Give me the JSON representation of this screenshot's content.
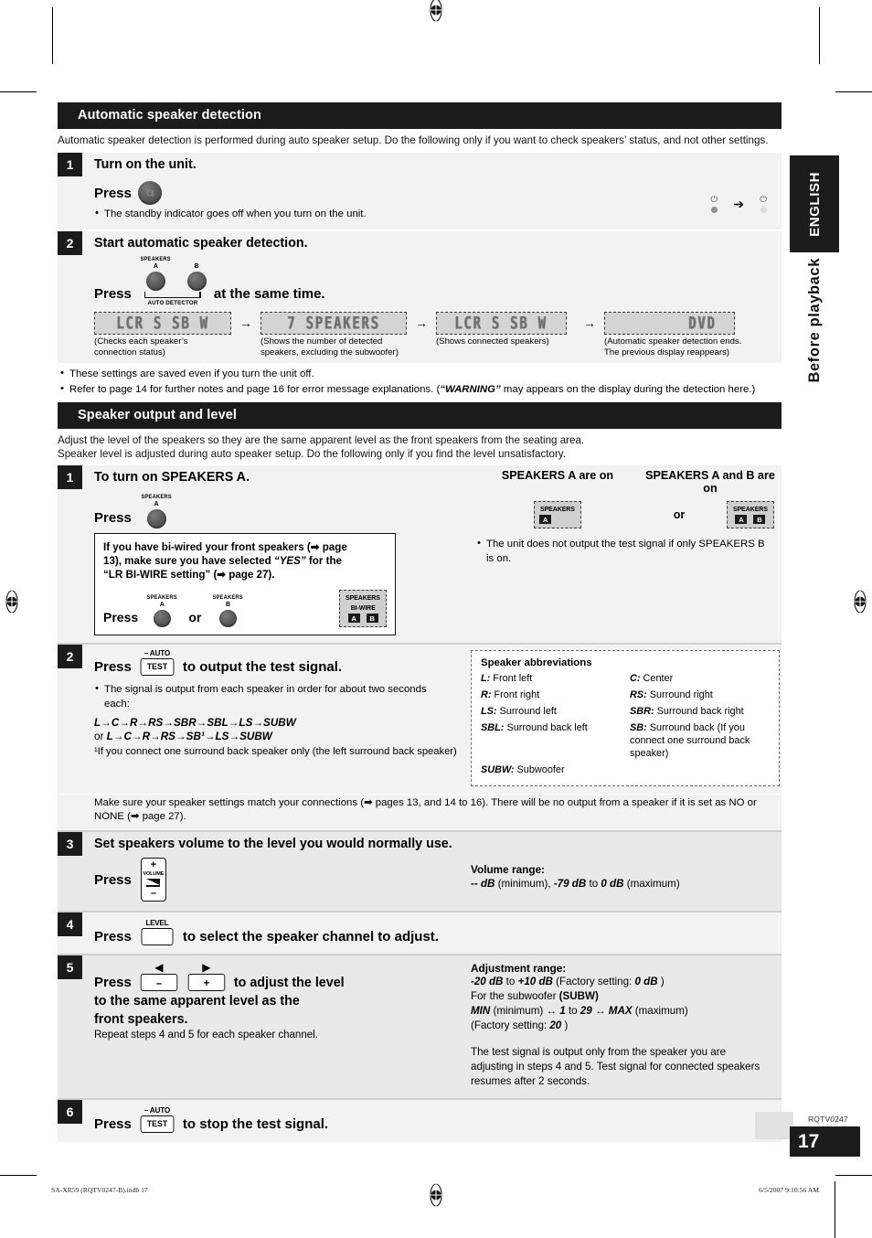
{
  "sidebar": {
    "language_tab": "ENGLISH",
    "chapter_title": "Before playback"
  },
  "page_marks": {
    "doc_code": "RQTV0247",
    "page_number": "17"
  },
  "footer": {
    "file_name": "SA-XR59 (RQTV0247-B).indb   17",
    "timestamp": "6/5/2007   9:10:56 AM"
  },
  "section1": {
    "heading": "Automatic speaker detection",
    "intro": "Automatic speaker detection is performed during auto speaker setup. Do the following only if you want to check speakers’ status, and not other settings.",
    "step1": {
      "num": "1",
      "title": "Turn on the unit.",
      "press_label": "Press",
      "button_icon": "power-button-icon",
      "bullet": "The standby indicator goes off when you turn on the unit.",
      "indicator_from": "standby-led-on",
      "indicator_arrow": "➔",
      "indicator_to": "standby-led-off"
    },
    "step2": {
      "num": "2",
      "title": "Start automatic speaker detection.",
      "press_label": "Press",
      "press_suffix": "at the same time.",
      "knob_a_top": "SPEAKERS",
      "knob_a_sub": "A",
      "knob_b_sub": "B",
      "bracket_label": "AUTO DETECTOR",
      "displays": [
        {
          "segment": "LCR S SB W",
          "caption": "(Checks each speaker’s connection status)"
        },
        {
          "segment": "7 SPEAKERS",
          "caption": "(Shows the number of detected speakers, excluding the subwoofer)"
        },
        {
          "segment": "LCR S SB W",
          "caption": "(Shows connected speakers)"
        },
        {
          "segment": "DVD",
          "caption": "(Automatic speaker detection ends. The previous display reappears)"
        }
      ],
      "display_arrow": "→",
      "notes": [
        "These settings are saved even if you turn the unit off.",
        "Refer to page 14 for further notes and page 16 for error message explanations. (“WARNING” may appears on the display during the detection here.)"
      ],
      "note2_prefix": "Refer to page 14 for further notes and page 16 for error message explanations. (",
      "note2_emph": "“WARNING”",
      "note2_suffix": " may appears on the display during the detection here.)"
    }
  },
  "section2": {
    "heading": "Speaker output and level",
    "intro_line1": "Adjust the level of the speakers so they are the same apparent level as the front speakers from the seating area.",
    "intro_line2": "Speaker level is adjusted during auto speaker setup. Do the following only if you find the level unsatisfactory.",
    "step1": {
      "num": "1",
      "title": "To turn on SPEAKERS A.",
      "press_label": "Press",
      "knob_top": "SPEAKERS",
      "knob_sub": "A",
      "callout_line1": "If you have bi-wired your front speakers (➡ page",
      "callout_line2_a": "13), make sure you have selected ",
      "callout_line2_b": "“YES”",
      "callout_line2_c": " for the",
      "callout_line3": "“LR BI-WIRE setting” (➡ page 27).",
      "callout_press": "Press",
      "callout_or": "or",
      "callout_knob_a_top": "SPEAKERS",
      "callout_knob_a_sub": "A",
      "callout_knob_b_top": "SPEAKERS",
      "callout_knob_b_sub": "B",
      "biwire_title": "SPEAKERS",
      "biwire_sub": "BI-WIRE",
      "biwire_a": "A",
      "biwire_b": "B",
      "right_label_a": "SPEAKERS A are on",
      "right_label_ab": "SPEAKERS A and B are on",
      "indicator_title": "SPEAKERS",
      "indicator_a": "A",
      "indicator_b": "B",
      "or_text": "or",
      "right_note": "The unit does not output the test signal if only SPEAKERS B is on."
    },
    "step2": {
      "num": "2",
      "press_label": "Press",
      "btn_top": "– AUTO",
      "btn_label": "TEST",
      "title_suffix": "to output the test signal.",
      "bullet": "The signal is output from each speaker in order for about two seconds each:",
      "order_line1": "L→C→R→RS→SBR→SBL→LS→SUBW",
      "order_line2_prefix": "or ",
      "order_line2": "L→C→R→RS→SB¹→LS→SUBW",
      "footnote": "¹If you connect one surround back speaker only (the left surround back speaker)",
      "closing": "Make sure your speaker settings match your connections (➡ pages 13, and 14 to 16). There will be no output from a speaker if it is set as NO or NONE (➡ page 27).",
      "abbr_heading": "Speaker abbreviations",
      "abbreviations": [
        {
          "key": "L:",
          "value": " Front left"
        },
        {
          "key": "C:",
          "value": " Center"
        },
        {
          "key": "R:",
          "value": " Front right"
        },
        {
          "key": "RS:",
          "value": " Surround right"
        },
        {
          "key": "LS:",
          "value": " Surround left"
        },
        {
          "key": "SBR:",
          "value": " Surround back right"
        },
        {
          "key": "SBL:",
          "value": " Surround back left"
        },
        {
          "key": "SB:",
          "value": " Surround back (If you connect one surround back speaker)"
        },
        {
          "key": "SUBW:",
          "value": " Subwoofer"
        }
      ]
    },
    "step3": {
      "num": "3",
      "title": "Set speakers volume to the level you would normally use.",
      "press_label": "Press",
      "volume_plus": "+",
      "volume_label": "VOLUME",
      "volume_minus": "–",
      "range_heading": "Volume range:",
      "range_v1": "-- dB",
      "range_t1": " (minimum), ",
      "range_v2": "-79 dB",
      "range_t2": " to ",
      "range_v3": "0 dB",
      "range_t3": " (maximum)"
    },
    "step4": {
      "num": "4",
      "press_label": "Press",
      "btn_top": "LEVEL",
      "btn_label": "",
      "title_suffix": "to select the speaker channel to adjust."
    },
    "step5": {
      "num": "5",
      "press_label": "Press",
      "btn_left_arrow": "◀",
      "btn_left": "–",
      "btn_right_arrow": "▶",
      "btn_right": "+",
      "title_line1": "to adjust the level",
      "title_line2": "to the same apparent level as the",
      "title_line3": "front speakers.",
      "subnote": "Repeat steps 4 and 5 for each speaker channel.",
      "range_heading": "Adjustment range:",
      "range_line1_a": "-20 dB",
      "range_line1_b": " to ",
      "range_line1_c": "+10 dB",
      "range_line1_d": " (Factory setting: ",
      "range_line1_e": "0 dB",
      "range_line1_f": " )",
      "range_line2_a": "For the subwoofer ",
      "range_line2_b": "(SUBW)",
      "range_line3_a": "MIN",
      "range_line3_b": " (minimum) ↔ ",
      "range_line3_c": "1",
      "range_line3_d": " to ",
      "range_line3_e": "29",
      "range_line3_f": " ↔ ",
      "range_line3_g": "MAX",
      "range_line3_h": " (maximum)",
      "range_line4_a": "(Factory setting: ",
      "range_line4_b": "20",
      "range_line4_c": " )",
      "test_note": "The test signal is output only from the speaker you are adjusting in steps 4 and 5. Test signal for connected speakers resumes after 2 seconds."
    },
    "step6": {
      "num": "6",
      "press_label": "Press",
      "btn_top": "– AUTO",
      "btn_label": "TEST",
      "title_suffix": "to stop the test signal."
    }
  }
}
